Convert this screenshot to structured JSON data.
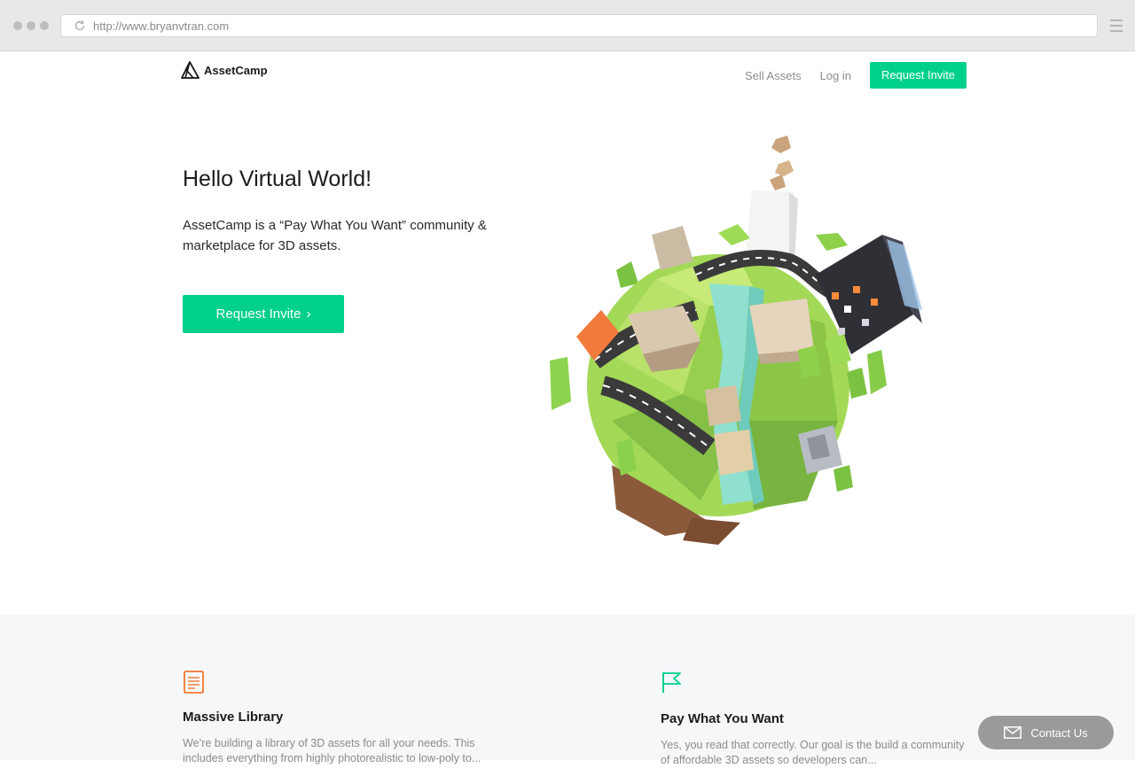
{
  "browser": {
    "url": "http://www.bryanvtran.com"
  },
  "site": {
    "brand": "AssetCamp",
    "nav": {
      "sell": "Sell Assets",
      "login": "Log in",
      "cta": "Request Invite"
    },
    "accent_color": "#00d08c"
  },
  "hero": {
    "title": "Hello Virtual World!",
    "description": "AssetCamp is a “Pay What You Want” community & marketplace for 3D assets.",
    "cta": "Request Invite",
    "cta_arrow": "›"
  },
  "features": [
    {
      "icon": "document-icon",
      "title": "Massive Library",
      "text": "We’re building a library of 3D assets for all your needs. This includes everything from highly photorealistic to low-poly to..."
    },
    {
      "icon": "flag-icon",
      "title": "Pay What You Want",
      "text": "Yes, you read that correctly. Our goal is the build a community of affordable 3D assets so developers can..."
    }
  ],
  "contact": {
    "label": "Contact Us"
  }
}
